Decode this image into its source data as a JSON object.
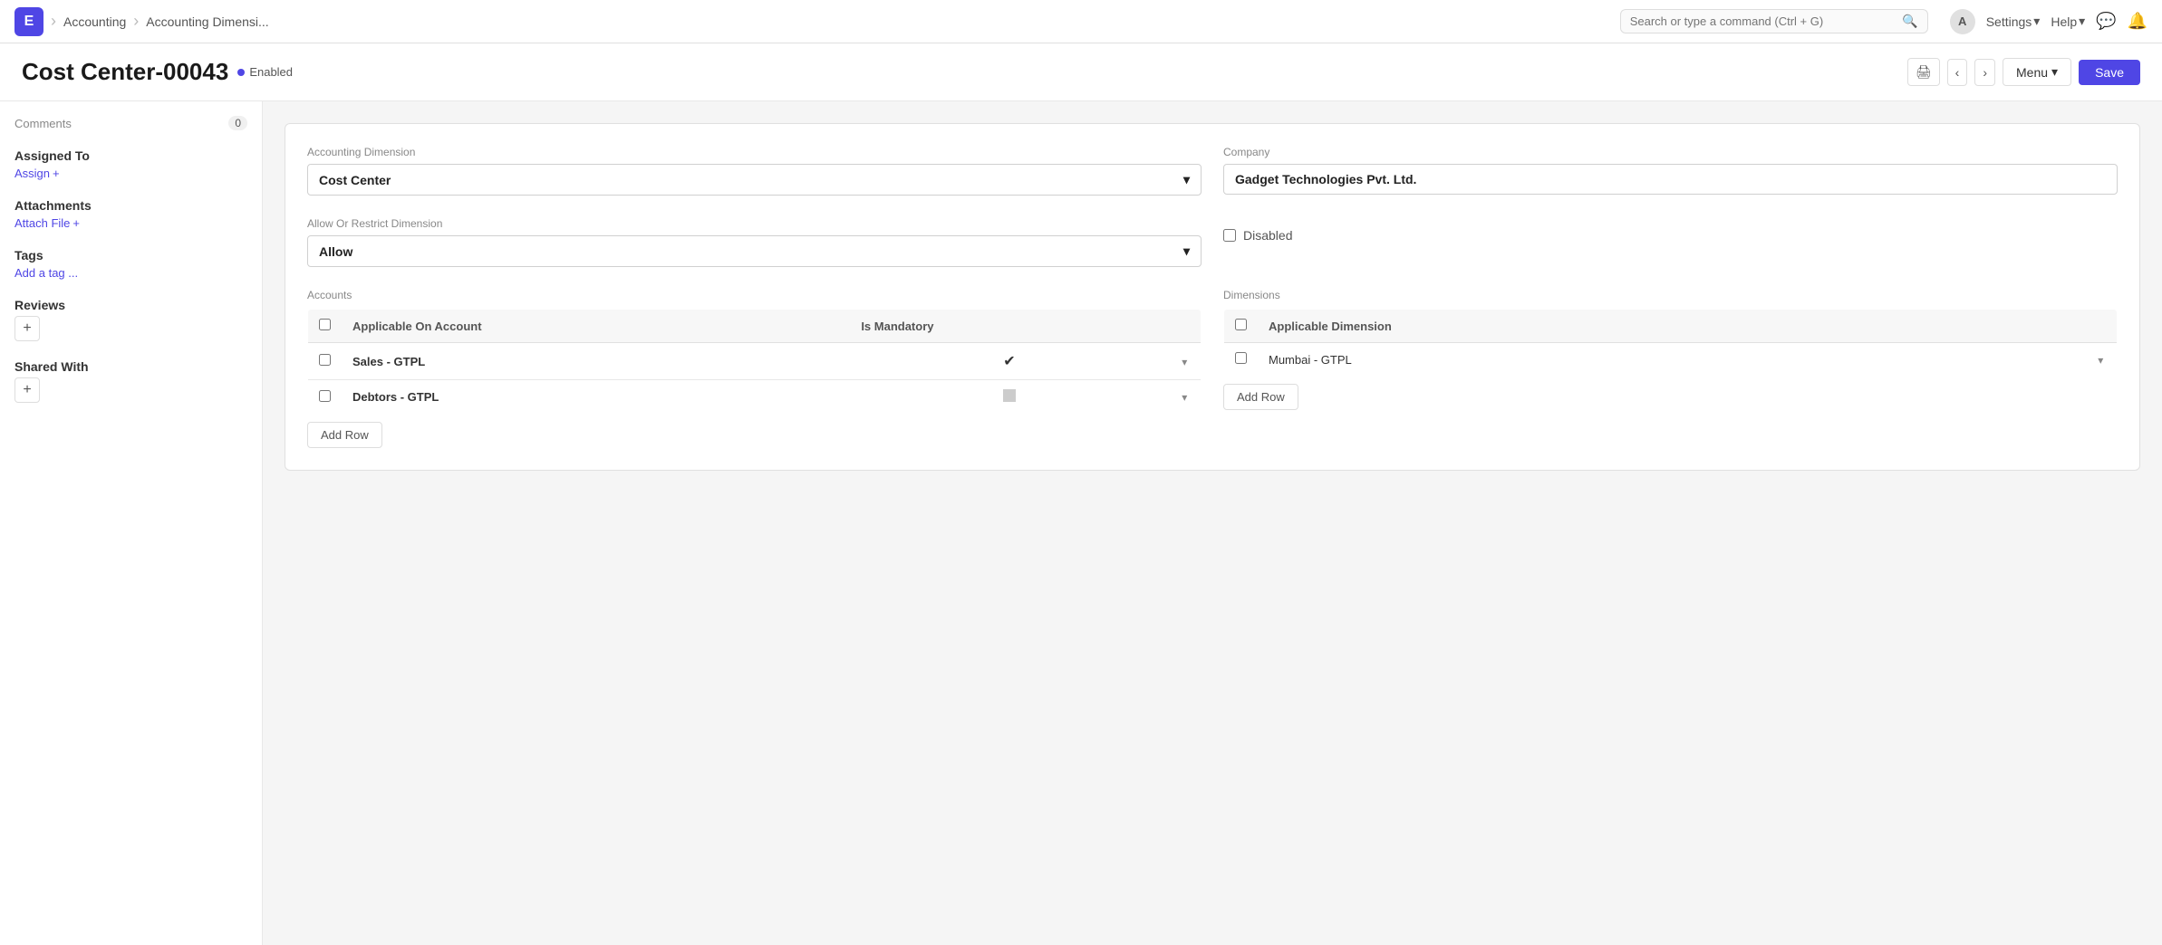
{
  "app": {
    "icon": "E",
    "nav": {
      "breadcrumb1": "Accounting",
      "breadcrumb2": "Accounting Dimensi...",
      "search_placeholder": "Search or type a command (Ctrl + G)",
      "settings_label": "Settings",
      "help_label": "Help",
      "avatar_letter": "A"
    }
  },
  "page": {
    "title": "Cost Center-00043",
    "status": "Enabled",
    "actions": {
      "menu_label": "Menu",
      "save_label": "Save"
    }
  },
  "sidebar": {
    "comments": {
      "label": "Comments",
      "count": "0"
    },
    "assigned_to": {
      "label": "Assigned To",
      "assign_label": "Assign"
    },
    "attachments": {
      "label": "Attachments",
      "attach_label": "Attach File"
    },
    "tags": {
      "label": "Tags",
      "add_label": "Add a tag ..."
    },
    "reviews": {
      "label": "Reviews"
    },
    "shared_with": {
      "label": "Shared With"
    }
  },
  "form": {
    "accounting_dimension": {
      "label": "Accounting Dimension",
      "value": "Cost Center"
    },
    "company": {
      "label": "Company",
      "value": "Gadget Technologies Pvt. Ltd."
    },
    "allow_or_restrict": {
      "label": "Allow Or Restrict Dimension",
      "value": "Allow"
    },
    "disabled": {
      "label": "Disabled",
      "checked": false
    }
  },
  "accounts_table": {
    "section_label": "Accounts",
    "headers": [
      "Applicable On Account",
      "Is Mandatory"
    ],
    "rows": [
      {
        "account": "Sales - GTPL",
        "is_mandatory": true
      },
      {
        "account": "Debtors - GTPL",
        "is_mandatory": false
      }
    ],
    "add_row_label": "Add Row"
  },
  "dimensions_table": {
    "section_label": "Dimensions",
    "headers": [
      "Applicable Dimension"
    ],
    "rows": [
      {
        "dimension": "Mumbai - GTPL"
      }
    ],
    "add_row_label": "Add Row"
  }
}
